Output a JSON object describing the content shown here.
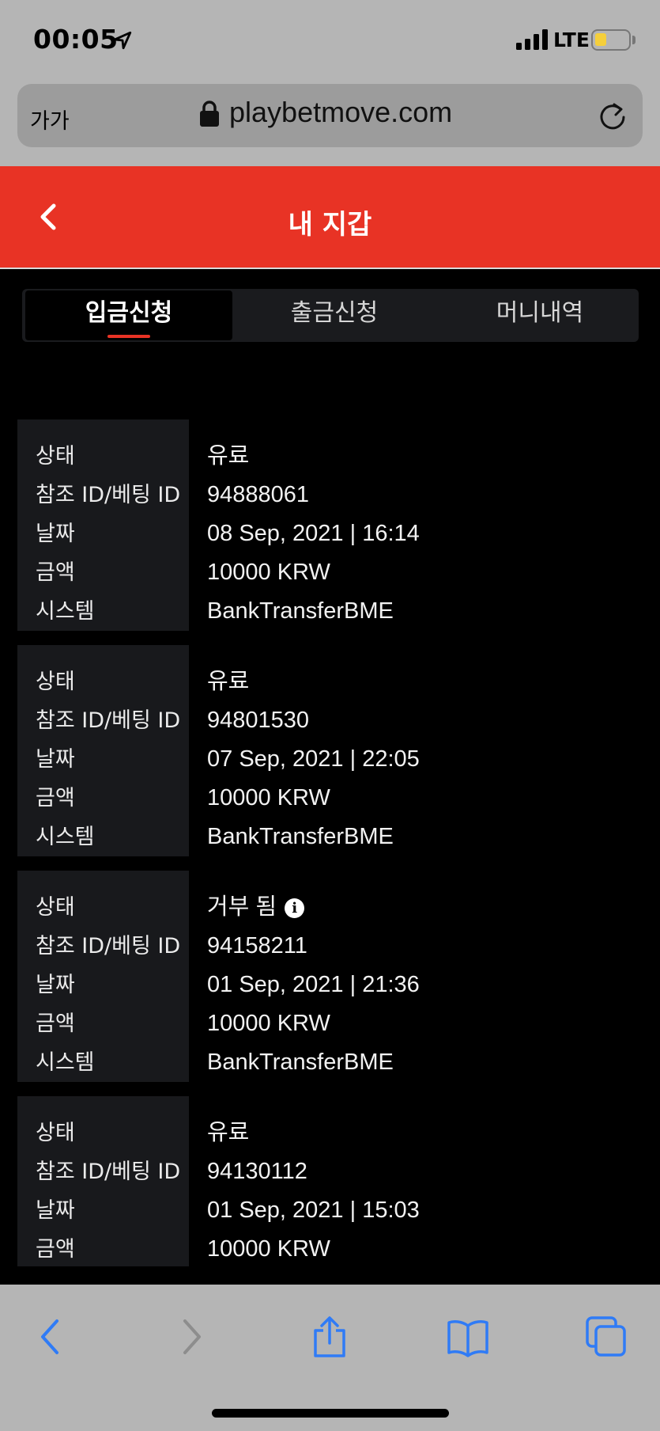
{
  "status_bar": {
    "time": "00:05",
    "network": "LTE"
  },
  "browser": {
    "text_size_label": "가가",
    "url": "playbetmove.com"
  },
  "header": {
    "title": "내 지갑"
  },
  "tabs": [
    {
      "label": "입금신청",
      "active": true
    },
    {
      "label": "출금신청",
      "active": false
    },
    {
      "label": "머니내역",
      "active": false
    }
  ],
  "field_labels": {
    "status": "상태",
    "ref_id": "참조 ID/베팅 ID",
    "date": "날짜",
    "amount": "금액",
    "system": "시스템"
  },
  "records": [
    {
      "status": "유료",
      "ref_id": "94888061",
      "date": "08 Sep, 2021 | 16:14",
      "amount": "10000 KRW",
      "system": "BankTransferBME"
    },
    {
      "status": "유료",
      "ref_id": "94801530",
      "date": "07 Sep, 2021 | 22:05",
      "amount": "10000 KRW",
      "system": "BankTransferBME"
    },
    {
      "status": "거부 됨",
      "ref_id": "94158211",
      "date": "01 Sep, 2021 | 21:36",
      "amount": "10000 KRW",
      "system": "BankTransferBME"
    },
    {
      "status": "유료",
      "ref_id": "94130112",
      "date": "01 Sep, 2021 | 15:03",
      "amount": "10000 KRW"
    }
  ],
  "colors": {
    "accent": "#e83325",
    "panel": "#18191c",
    "chrome": "#b5b5b5",
    "ios_blue": "#2f7bf6"
  }
}
